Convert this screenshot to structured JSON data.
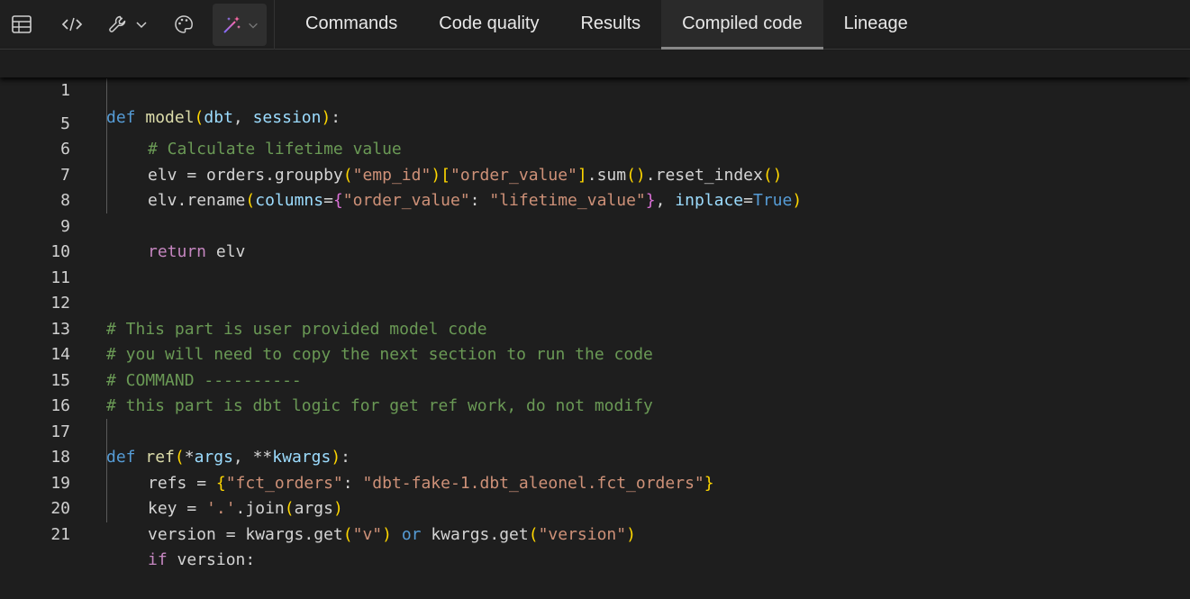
{
  "toolbar": {
    "icons": [
      "table-icon",
      "code-icon",
      "wrench-icon",
      "chevron-down-icon",
      "palette-icon",
      "magic-wand-icon",
      "chevron-down-icon"
    ]
  },
  "tabs": [
    {
      "label": "Commands",
      "active": false
    },
    {
      "label": "Code quality",
      "active": false
    },
    {
      "label": "Results",
      "active": false
    },
    {
      "label": "Compiled code",
      "active": true
    },
    {
      "label": "Lineage",
      "active": false
    }
  ],
  "sticky_line": {
    "number": "1"
  },
  "line_numbers": [
    "5",
    "6",
    "7",
    "8",
    "9",
    "10",
    "11",
    "12",
    "13",
    "14",
    "15",
    "16",
    "17",
    "18",
    "19",
    "20",
    "21"
  ],
  "code": {
    "l5_comment": "# Calculate lifetime value",
    "l6_elv": "elv",
    "l6_orders": "orders",
    "l6_groupby": "groupby",
    "l6_emp_id": "\"emp_id\"",
    "l6_order_value": "\"order_value\"",
    "l6_sum": "sum",
    "l6_reset_index": "reset_index",
    "l7_rename": "rename",
    "l7_columns": "columns",
    "l7_key": "\"order_value\"",
    "l7_val": "\"lifetime_value\"",
    "l7_inplace": "inplace",
    "l7_true": "True",
    "l9_return": "return",
    "l9_elv": "elv",
    "l12": "# This part is user provided model code",
    "l13": "# you will need to copy the next section to run the code",
    "l14": "# COMMAND ----------",
    "l15": "# this part is dbt logic for get ref work, do not modify",
    "l17_def": "def",
    "l17_ref": "ref",
    "l17_args": "args",
    "l17_kwargs": "kwargs",
    "l18_refs": "refs",
    "l18_key": "\"fct_orders\"",
    "l18_val": "\"dbt-fake-1.dbt_aleonel.fct_orders\"",
    "l19_key": "key",
    "l19_dot": "'.'",
    "l19_join": "join",
    "l19_args": "args",
    "l20_version": "version",
    "l20_kwargs": "kwargs",
    "l20_get": "get",
    "l20_v": "\"v\"",
    "l20_or": "or",
    "l20_version_str": "\"version\"",
    "l21_if": "if",
    "l21_version": "version",
    "sticky_def": "def",
    "sticky_model": "model",
    "sticky_dbt": "dbt",
    "sticky_session": "session"
  }
}
